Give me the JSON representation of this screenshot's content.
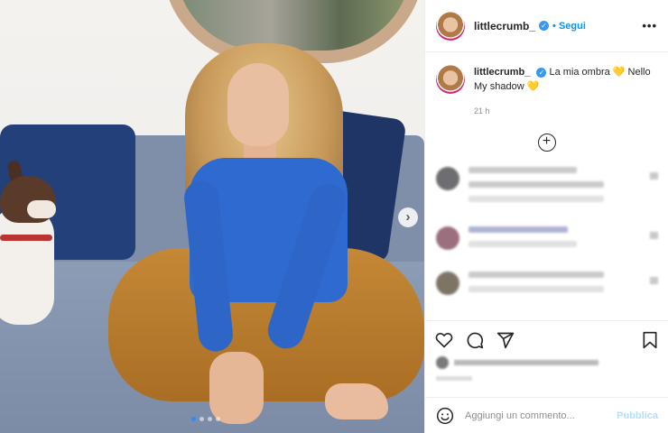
{
  "header": {
    "username": "littlecrumb_",
    "follow_label": "Segui",
    "more_label": "•••"
  },
  "caption": {
    "username": "littlecrumb_",
    "text": "La mia ombra 💛 Nello My shadow 💛",
    "time": "21 h"
  },
  "load_more_label": "+",
  "photo": {
    "next_label": "›",
    "slides": 4,
    "active_slide": 1
  },
  "comment_box": {
    "placeholder": "Aggiungi un commento...",
    "publish_label": "Pubblica"
  },
  "icons": {
    "like": "heart-icon",
    "comment": "comment-icon",
    "share": "share-icon",
    "save": "bookmark-icon",
    "emoji": "emoji-icon",
    "verified": "verified-badge-icon"
  },
  "colors": {
    "accent": "#0095f6",
    "publish_disabled": "#b2dffc",
    "verified": "#3897f0"
  }
}
